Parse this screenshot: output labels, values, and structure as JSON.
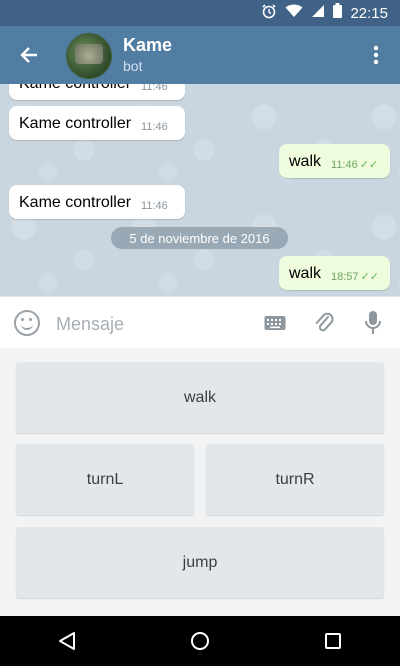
{
  "status_bar": {
    "time": "22:15"
  },
  "header": {
    "title": "Kame",
    "subtitle": "bot"
  },
  "messages": [
    {
      "text": "Kame controller",
      "time": "11:46",
      "direction": "in"
    },
    {
      "text": "Kame controller",
      "time": "11:46",
      "direction": "in"
    },
    {
      "text": "walk",
      "time": "11:46",
      "direction": "out"
    },
    {
      "text": "Kame controller",
      "time": "11:46",
      "direction": "in"
    },
    {
      "text": "walk",
      "time": "18:57",
      "direction": "out"
    }
  ],
  "date_separator": "5 de noviembre de 2016",
  "composer": {
    "placeholder": "Mensaje"
  },
  "bot_keyboard": {
    "walk": "walk",
    "turnL": "turnL",
    "turnR": "turnR",
    "jump": "jump"
  },
  "colors": {
    "header": "#527da3",
    "status_bar": "#3f6286",
    "outgoing_bubble": "#effdde",
    "chat_bg": "#c9d6df"
  }
}
